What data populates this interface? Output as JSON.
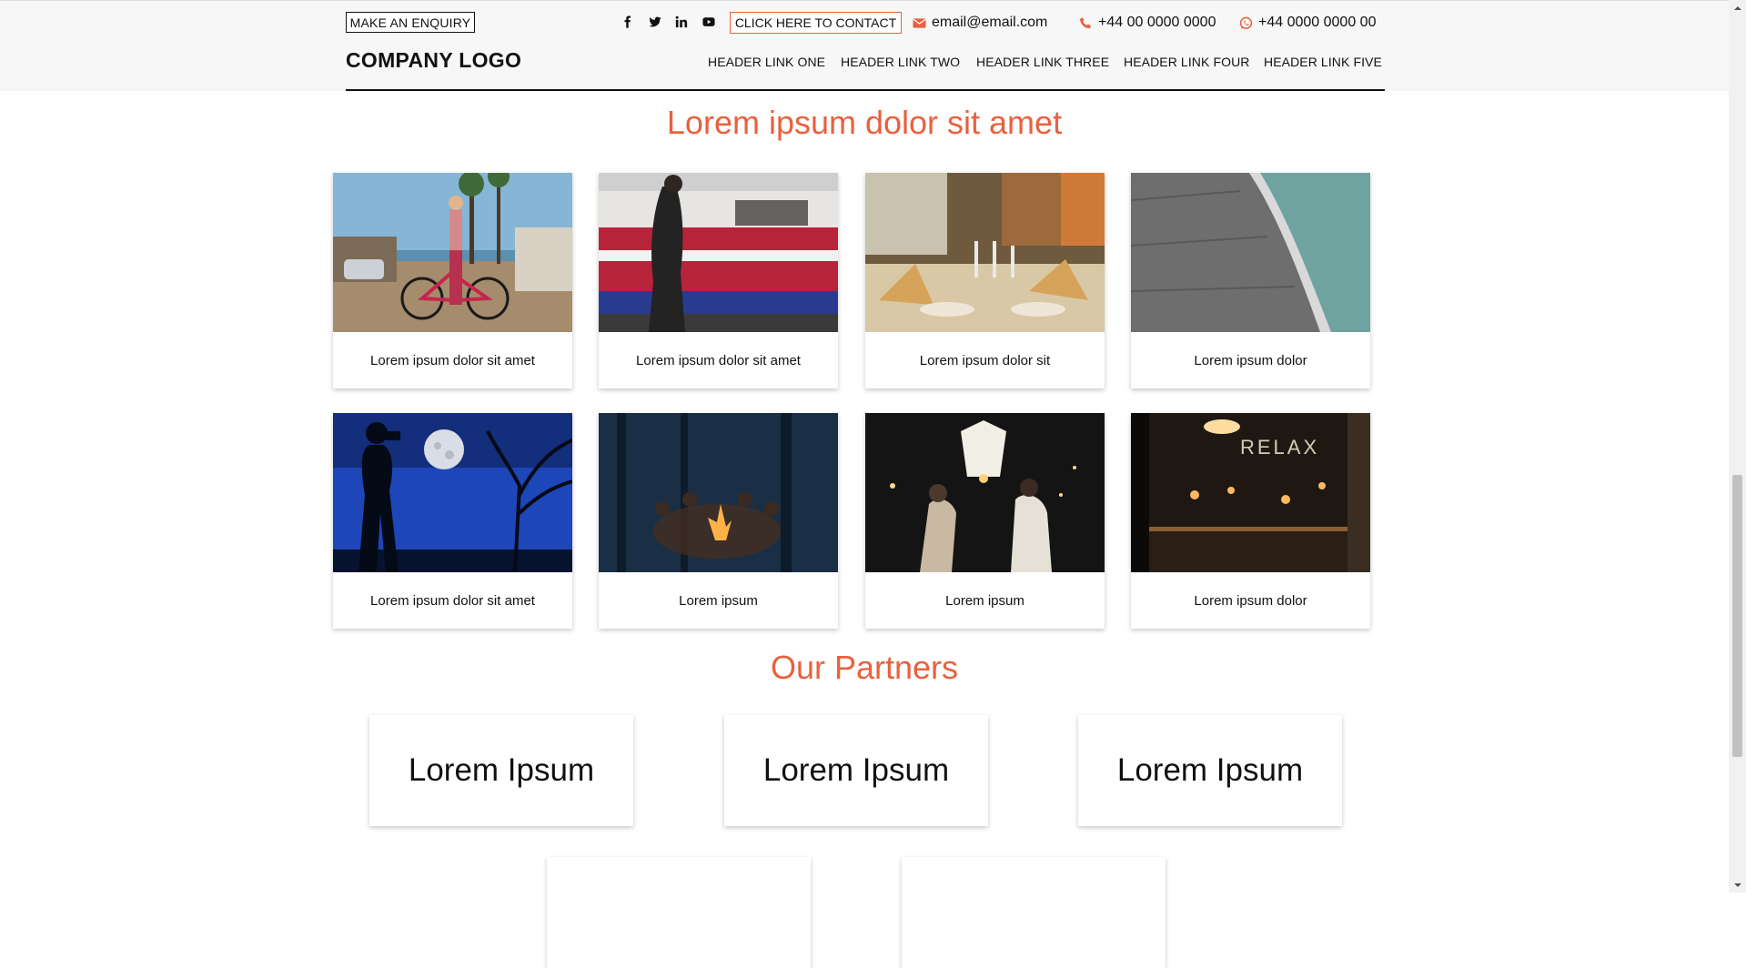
{
  "header": {
    "enquiry_label": "MAKE AN ENQUIRY",
    "contact_label": "CLICK HERE TO CONTACT",
    "email": "email@email.com",
    "phone": "+44 00 0000 0000",
    "whatsapp": "+44 0000 0000 00",
    "logo": "COMPANY LOGO",
    "nav": [
      "HEADER LINK ONE",
      "HEADER LINK TWO",
      "HEADER LINK THREE",
      "HEADER LINK FOUR",
      "HEADER LINK FIVE"
    ],
    "social_icons": [
      "facebook-icon",
      "twitter-icon",
      "linkedin-icon",
      "youtube-icon"
    ],
    "contact_icons": [
      "envelope-icon",
      "phone-icon",
      "whatsapp-icon"
    ]
  },
  "gallery": {
    "title": "Lorem ipsum dolor sit amet",
    "cards": [
      {
        "caption": "Lorem ipsum dolor sit amet",
        "image": "woman-with-bicycle-street"
      },
      {
        "caption": "Lorem ipsum dolor sit amet",
        "image": "man-walking-by-moving-train"
      },
      {
        "caption": "Lorem ipsum dolor sit",
        "image": "restaurant-table-setting"
      },
      {
        "caption": "Lorem ipsum dolor",
        "image": "dam-wall-and-water"
      },
      {
        "caption": "Lorem ipsum dolor sit amet",
        "image": "photographer-silhouette-moon"
      },
      {
        "caption": "Lorem ipsum",
        "image": "campfire-in-forest"
      },
      {
        "caption": "Lorem ipsum",
        "image": "sky-lantern-release-night"
      },
      {
        "caption": "Lorem ipsum dolor",
        "image": "relax-bar-interior"
      }
    ]
  },
  "partners": {
    "title": "Our Partners",
    "items": [
      "Lorem Ipsum",
      "Lorem Ipsum",
      "Lorem Ipsum",
      "",
      ""
    ]
  },
  "colors": {
    "accent": "#e8613e",
    "header_bg": "#f7f7f7",
    "text": "#111111"
  }
}
